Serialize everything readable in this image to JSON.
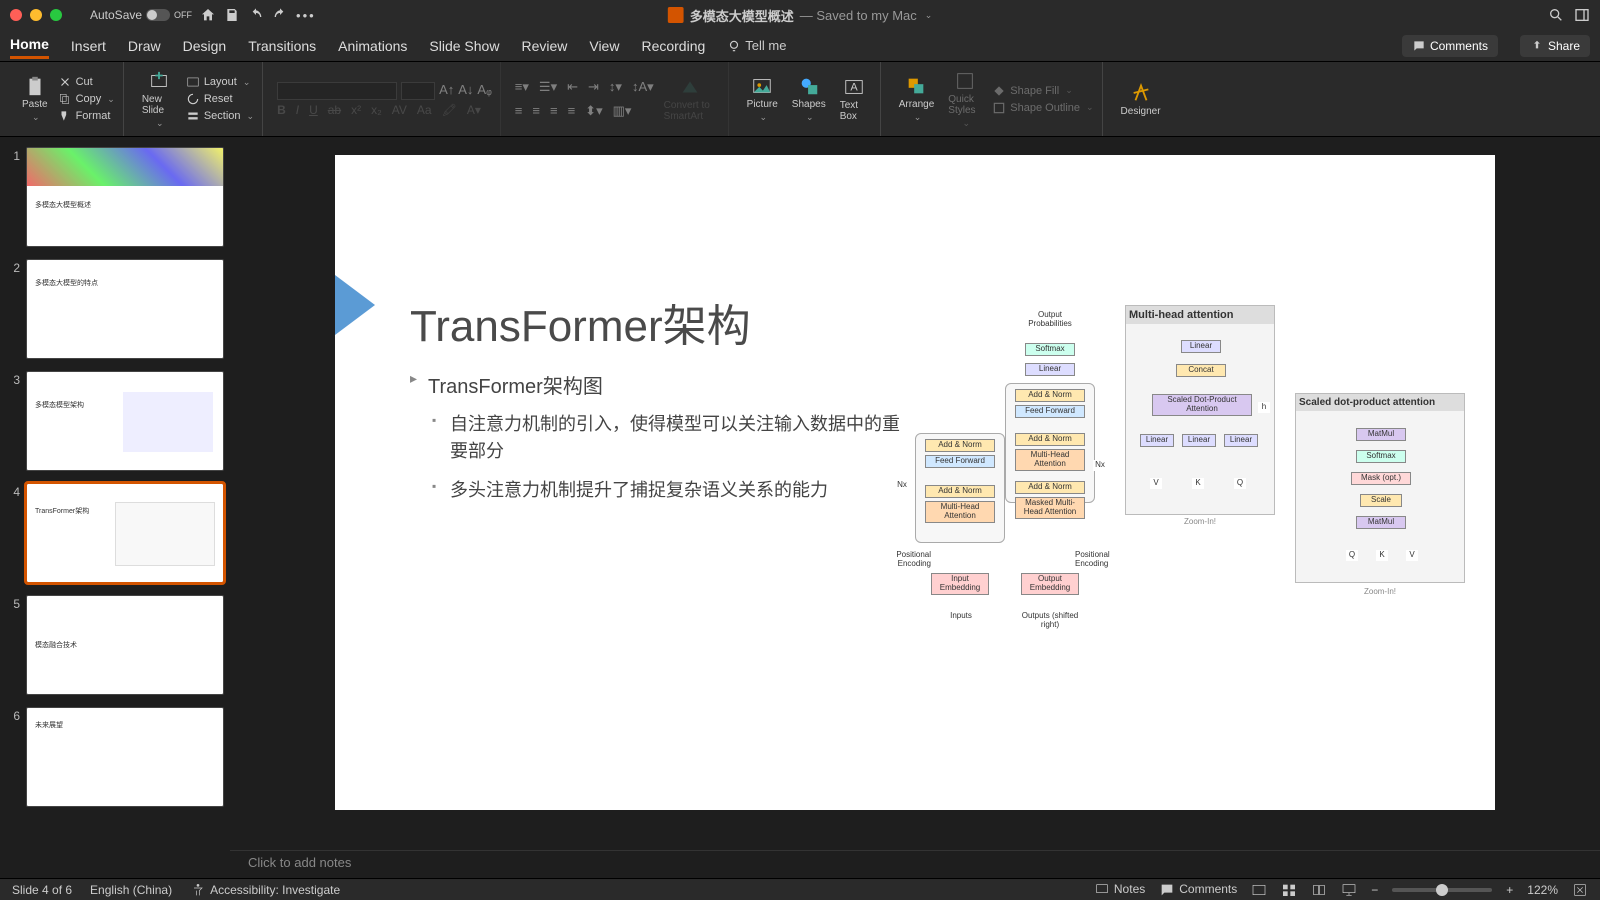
{
  "titlebar": {
    "autosave_label": "AutoSave",
    "autosave_state": "OFF",
    "doc_title": "多模态大模型概述",
    "saved_text": "— Saved to my Mac"
  },
  "tabs": {
    "items": [
      "Home",
      "Insert",
      "Draw",
      "Design",
      "Transitions",
      "Animations",
      "Slide Show",
      "Review",
      "View",
      "Recording"
    ],
    "active": 0,
    "tell_me": "Tell me",
    "comments_btn": "Comments",
    "share_btn": "Share"
  },
  "ribbon": {
    "paste": "Paste",
    "cut": "Cut",
    "copy": "Copy",
    "format": "Format",
    "new_slide": "New Slide",
    "layout": "Layout",
    "reset": "Reset",
    "section": "Section",
    "convert": "Convert to SmartArt",
    "picture": "Picture",
    "shapes": "Shapes",
    "textbox": "Text Box",
    "arrange": "Arrange",
    "quick_styles": "Quick Styles",
    "shape_fill": "Shape Fill",
    "shape_outline": "Shape Outline",
    "designer": "Designer"
  },
  "thumbnails": [
    {
      "n": 1,
      "title": "多模态大模型概述"
    },
    {
      "n": 2,
      "title": "多模态大模型的特点"
    },
    {
      "n": 3,
      "title": "多模态模型架构"
    },
    {
      "n": 4,
      "title": "TransFormer架构"
    },
    {
      "n": 5,
      "title": "模态融合技术"
    },
    {
      "n": 6,
      "title": "未来展望"
    }
  ],
  "selected_thumb": 4,
  "slide": {
    "title": "TransFormer架构",
    "bullets": {
      "b1": "TransFormer架构图",
      "b2a": "自注意力机制的引入，使得模型可以关注输入数据中的重要部分",
      "b2b": "多头注意力机制提升了捕捉复杂语义关系的能力"
    },
    "diagram": {
      "output_prob": "Output Probabilities",
      "softmax": "Softmax",
      "linear": "Linear",
      "addnorm": "Add & Norm",
      "feedforward": "Feed Forward",
      "mha": "Multi-Head Attention",
      "masked_mha": "Masked Multi-Head Attention",
      "pos_enc_l": "Positional Encoding",
      "pos_enc_r": "Positional Encoding",
      "in_emb": "Input Embedding",
      "out_emb": "Output Embedding",
      "inputs": "Inputs",
      "outputs": "Outputs (shifted right)",
      "nx": "Nx",
      "mha_title": "Multi-head attention",
      "concat": "Concat",
      "sdpa": "Scaled Dot-Product Attention",
      "V": "V",
      "K": "K",
      "Q": "Q",
      "h": "h",
      "zoom": "Zoom-In!",
      "sdpa_title": "Scaled dot-product attention",
      "matmul": "MatMul",
      "mask": "Mask (opt.)",
      "scale": "Scale"
    }
  },
  "notes_placeholder": "Click to add notes",
  "status": {
    "slide_pos": "Slide 4 of 6",
    "lang": "English (China)",
    "access": "Accessibility: Investigate",
    "notes": "Notes",
    "comments": "Comments",
    "zoom": "122%"
  }
}
